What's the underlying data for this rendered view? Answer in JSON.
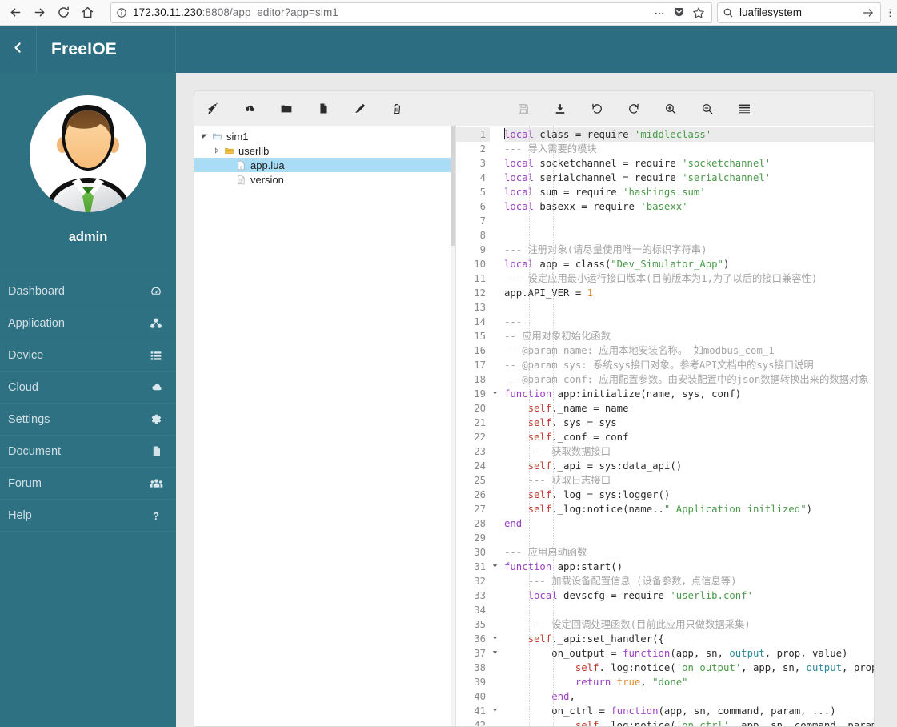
{
  "browser": {
    "back_icon": "arrow-left-icon",
    "forward_icon": "arrow-right-icon",
    "reload_icon": "reload-icon",
    "home_icon": "home-icon",
    "url_info_icon": "info-circle-icon",
    "url_value": "172.30.11.230:8808/app_editor?app=sim1",
    "url_host": "172.30.11.230",
    "url_port_path": ":8808/app_editor?app=sim1",
    "overflow_icon": "ellipsis-icon",
    "pocket_icon": "pocket-icon",
    "bookmark_icon": "star-icon",
    "search_icon": "search-icon",
    "search_value": "luafilesystem",
    "search_go_icon": "arrow-right-icon",
    "chrome_menu_icon": "vertical-ellipsis-icon"
  },
  "header": {
    "back_icon": "chevron-left-icon",
    "brand": "FreeIOE",
    "bg_color": "#2c6d82"
  },
  "sidebar": {
    "bg_color": "#2e7183",
    "avatar_name": "avatar",
    "username": "admin",
    "items": [
      {
        "label": "Dashboard",
        "icon": "dashboard-icon"
      },
      {
        "label": "Application",
        "icon": "cubes-icon"
      },
      {
        "label": "Device",
        "icon": "list-icon"
      },
      {
        "label": "Cloud",
        "icon": "cloud-icon"
      },
      {
        "label": "Settings",
        "icon": "gear-icon"
      },
      {
        "label": "Document",
        "icon": "file-icon"
      },
      {
        "label": "Forum",
        "icon": "users-icon"
      },
      {
        "label": "Help",
        "icon": "question-mark-icon"
      }
    ]
  },
  "toolbar": {
    "buttons": [
      {
        "name": "deploy-button",
        "icon": "rocket-icon",
        "enabled": true
      },
      {
        "name": "upload-button",
        "icon": "cloud-upload-icon",
        "enabled": true
      },
      {
        "name": "new-folder-button",
        "icon": "folder-icon",
        "enabled": true
      },
      {
        "name": "new-file-button",
        "icon": "file-icon",
        "enabled": true
      },
      {
        "name": "rename-button",
        "icon": "pencil-icon",
        "enabled": true
      },
      {
        "name": "delete-button",
        "icon": "trash-icon",
        "enabled": true
      },
      {
        "name": "save-button",
        "icon": "floppy-disk-icon",
        "enabled": false
      },
      {
        "name": "download-button",
        "icon": "download-icon",
        "enabled": true
      },
      {
        "name": "undo-button",
        "icon": "undo-icon",
        "enabled": true
      },
      {
        "name": "redo-button",
        "icon": "redo-icon",
        "enabled": true
      },
      {
        "name": "zoom-in-button",
        "icon": "magnifier-plus-icon",
        "enabled": true
      },
      {
        "name": "zoom-out-button",
        "icon": "magnifier-minus-icon",
        "enabled": true
      },
      {
        "name": "menu-button",
        "icon": "hamburger-icon",
        "enabled": true
      }
    ]
  },
  "filetree": {
    "rows": [
      {
        "label": "sim1",
        "depth": 0,
        "type": "folder",
        "expanded": true,
        "selected": false,
        "icon": "folder-open-icon"
      },
      {
        "label": "userlib",
        "depth": 1,
        "type": "folder",
        "expanded": false,
        "selected": false,
        "icon": "folder-icon"
      },
      {
        "label": "app.lua",
        "depth": 2,
        "type": "lua",
        "expanded": null,
        "selected": true,
        "icon": "lua-file-icon"
      },
      {
        "label": "version",
        "depth": 2,
        "type": "file",
        "expanded": null,
        "selected": false,
        "icon": "text-file-icon"
      }
    ]
  },
  "editor": {
    "language": "lua",
    "filename": "app.lua",
    "active_line": 1,
    "first_visible_line": 1,
    "last_visible_line": 42,
    "fold_lines": [
      19,
      31,
      36,
      37,
      41
    ],
    "lines": [
      {
        "n": 1,
        "tokens": [
          {
            "t": "caret"
          },
          {
            "t": "k",
            "v": "local"
          },
          {
            "t": "p",
            "v": " class = require "
          },
          {
            "t": "s",
            "v": "'middleclass'"
          }
        ]
      },
      {
        "n": 2,
        "tokens": [
          {
            "t": "c",
            "v": "--- 导入需要的模块"
          }
        ]
      },
      {
        "n": 3,
        "tokens": [
          {
            "t": "k",
            "v": "local"
          },
          {
            "t": "p",
            "v": " socketchannel = require "
          },
          {
            "t": "s",
            "v": "'socketchannel'"
          }
        ]
      },
      {
        "n": 4,
        "tokens": [
          {
            "t": "k",
            "v": "local"
          },
          {
            "t": "p",
            "v": " serialchannel = require "
          },
          {
            "t": "s",
            "v": "'serialchannel'"
          }
        ]
      },
      {
        "n": 5,
        "tokens": [
          {
            "t": "k",
            "v": "local"
          },
          {
            "t": "p",
            "v": " sum = require "
          },
          {
            "t": "s",
            "v": "'hashings.sum'"
          }
        ]
      },
      {
        "n": 6,
        "tokens": [
          {
            "t": "k",
            "v": "local"
          },
          {
            "t": "p",
            "v": " basexx = require "
          },
          {
            "t": "s",
            "v": "'basexx'"
          }
        ]
      },
      {
        "n": 7,
        "tokens": []
      },
      {
        "n": 8,
        "tokens": []
      },
      {
        "n": 9,
        "tokens": [
          {
            "t": "c",
            "v": "--- 注册对象(请尽量使用唯一的标识字符串)"
          }
        ]
      },
      {
        "n": 10,
        "tokens": [
          {
            "t": "k",
            "v": "local"
          },
          {
            "t": "p",
            "v": " app = class("
          },
          {
            "t": "s",
            "v": "\"Dev_Simulator_App\""
          },
          {
            "t": "p",
            "v": ")"
          }
        ]
      },
      {
        "n": 11,
        "tokens": [
          {
            "t": "c",
            "v": "--- 设定应用最小运行接口版本(目前版本为1,为了以后的接口兼容性)"
          }
        ]
      },
      {
        "n": 12,
        "tokens": [
          {
            "t": "p",
            "v": "app.API_VER = "
          },
          {
            "t": "n",
            "v": "1"
          }
        ]
      },
      {
        "n": 13,
        "tokens": []
      },
      {
        "n": 14,
        "tokens": [
          {
            "t": "c",
            "v": "---"
          }
        ]
      },
      {
        "n": 15,
        "tokens": [
          {
            "t": "c",
            "v": "-- 应用对象初始化函数"
          }
        ]
      },
      {
        "n": 16,
        "tokens": [
          {
            "t": "c",
            "v": "-- @param name: 应用本地安装名称。 如modbus_com_1"
          }
        ]
      },
      {
        "n": 17,
        "tokens": [
          {
            "t": "c",
            "v": "-- @param sys: 系统sys接口对象。参考API文档中的sys接口说明"
          }
        ]
      },
      {
        "n": 18,
        "tokens": [
          {
            "t": "c",
            "v": "-- @param conf: 应用配置参数。由安装配置中的json数据转换出来的数据对象"
          }
        ]
      },
      {
        "n": 19,
        "tokens": [
          {
            "t": "k",
            "v": "function"
          },
          {
            "t": "p",
            "v": " app:initialize(name, sys, conf)"
          }
        ]
      },
      {
        "n": 20,
        "tokens": [
          {
            "t": "p",
            "v": "    "
          },
          {
            "t": "sf",
            "v": "self"
          },
          {
            "t": "p",
            "v": "._name = name"
          }
        ]
      },
      {
        "n": 21,
        "tokens": [
          {
            "t": "p",
            "v": "    "
          },
          {
            "t": "sf",
            "v": "self"
          },
          {
            "t": "p",
            "v": "._sys = sys"
          }
        ]
      },
      {
        "n": 22,
        "tokens": [
          {
            "t": "p",
            "v": "    "
          },
          {
            "t": "sf",
            "v": "self"
          },
          {
            "t": "p",
            "v": "._conf = conf"
          }
        ]
      },
      {
        "n": 23,
        "tokens": [
          {
            "t": "p",
            "v": "    "
          },
          {
            "t": "c",
            "v": "--- 获取数据接口"
          }
        ]
      },
      {
        "n": 24,
        "tokens": [
          {
            "t": "p",
            "v": "    "
          },
          {
            "t": "sf",
            "v": "self"
          },
          {
            "t": "p",
            "v": "._api = sys:data_api()"
          }
        ]
      },
      {
        "n": 25,
        "tokens": [
          {
            "t": "p",
            "v": "    "
          },
          {
            "t": "c",
            "v": "--- 获取日志接口"
          }
        ]
      },
      {
        "n": 26,
        "tokens": [
          {
            "t": "p",
            "v": "    "
          },
          {
            "t": "sf",
            "v": "self"
          },
          {
            "t": "p",
            "v": "._log = sys:logger()"
          }
        ]
      },
      {
        "n": 27,
        "tokens": [
          {
            "t": "p",
            "v": "    "
          },
          {
            "t": "sf",
            "v": "self"
          },
          {
            "t": "p",
            "v": "._log:notice(name.."
          },
          {
            "t": "s",
            "v": "\" Application initlized\""
          },
          {
            "t": "p",
            "v": ")"
          }
        ]
      },
      {
        "n": 28,
        "tokens": [
          {
            "t": "k",
            "v": "end"
          }
        ]
      },
      {
        "n": 29,
        "tokens": []
      },
      {
        "n": 30,
        "tokens": [
          {
            "t": "c",
            "v": "--- 应用启动函数"
          }
        ]
      },
      {
        "n": 31,
        "tokens": [
          {
            "t": "k",
            "v": "function"
          },
          {
            "t": "p",
            "v": " app:start()"
          }
        ]
      },
      {
        "n": 32,
        "tokens": [
          {
            "t": "p",
            "v": "    "
          },
          {
            "t": "c",
            "v": "--- 加载设备配置信息 (设备参数，点信息等)"
          }
        ]
      },
      {
        "n": 33,
        "tokens": [
          {
            "t": "p",
            "v": "    "
          },
          {
            "t": "k",
            "v": "local"
          },
          {
            "t": "p",
            "v": " devscfg = require "
          },
          {
            "t": "s",
            "v": "'userlib.conf'"
          }
        ]
      },
      {
        "n": 34,
        "tokens": []
      },
      {
        "n": 35,
        "tokens": [
          {
            "t": "p",
            "v": "    "
          },
          {
            "t": "c",
            "v": "--- 设定回调处理函数(目前此应用只做数据采集)"
          }
        ]
      },
      {
        "n": 36,
        "tokens": [
          {
            "t": "p",
            "v": "    "
          },
          {
            "t": "sf",
            "v": "self"
          },
          {
            "t": "p",
            "v": "._api:set_handler({"
          }
        ]
      },
      {
        "n": 37,
        "tokens": [
          {
            "t": "p",
            "v": "        on_output = "
          },
          {
            "t": "k",
            "v": "function"
          },
          {
            "t": "p",
            "v": "(app, sn, "
          },
          {
            "t": "id",
            "v": "output"
          },
          {
            "t": "p",
            "v": ", prop, value)"
          }
        ]
      },
      {
        "n": 38,
        "tokens": [
          {
            "t": "p",
            "v": "            "
          },
          {
            "t": "sf",
            "v": "self"
          },
          {
            "t": "p",
            "v": "._log:notice("
          },
          {
            "t": "s",
            "v": "'on_output'"
          },
          {
            "t": "p",
            "v": ", app, sn, "
          },
          {
            "t": "id",
            "v": "output"
          },
          {
            "t": "p",
            "v": ", prop, value)"
          }
        ]
      },
      {
        "n": 39,
        "tokens": [
          {
            "t": "p",
            "v": "            "
          },
          {
            "t": "k",
            "v": "return"
          },
          {
            "t": "p",
            "v": " "
          },
          {
            "t": "n",
            "v": "true"
          },
          {
            "t": "p",
            "v": ", "
          },
          {
            "t": "s",
            "v": "\"done\""
          }
        ]
      },
      {
        "n": 40,
        "tokens": [
          {
            "t": "p",
            "v": "        "
          },
          {
            "t": "k",
            "v": "end"
          },
          {
            "t": "p",
            "v": ","
          }
        ]
      },
      {
        "n": 41,
        "tokens": [
          {
            "t": "p",
            "v": "        on_ctrl = "
          },
          {
            "t": "k",
            "v": "function"
          },
          {
            "t": "p",
            "v": "(app, sn, command, param, ...)"
          }
        ]
      },
      {
        "n": 42,
        "tokens": [
          {
            "t": "p",
            "v": "            "
          },
          {
            "t": "sf",
            "v": "self"
          },
          {
            "t": "p",
            "v": "._log:notice("
          },
          {
            "t": "s",
            "v": "'on_ctrl'"
          },
          {
            "t": "p",
            "v": ", app, sn ,command, param, ...)"
          }
        ]
      }
    ],
    "colors": {
      "keyword": "#9b3fc4",
      "string": "#4a9a4a",
      "comment": "#a5a5a5",
      "number": "#e08e29",
      "self": "#c0392b",
      "identifier": "#2b8a9a",
      "text": "#2a2a2a",
      "active_line_bg": "#ebebeb"
    }
  }
}
